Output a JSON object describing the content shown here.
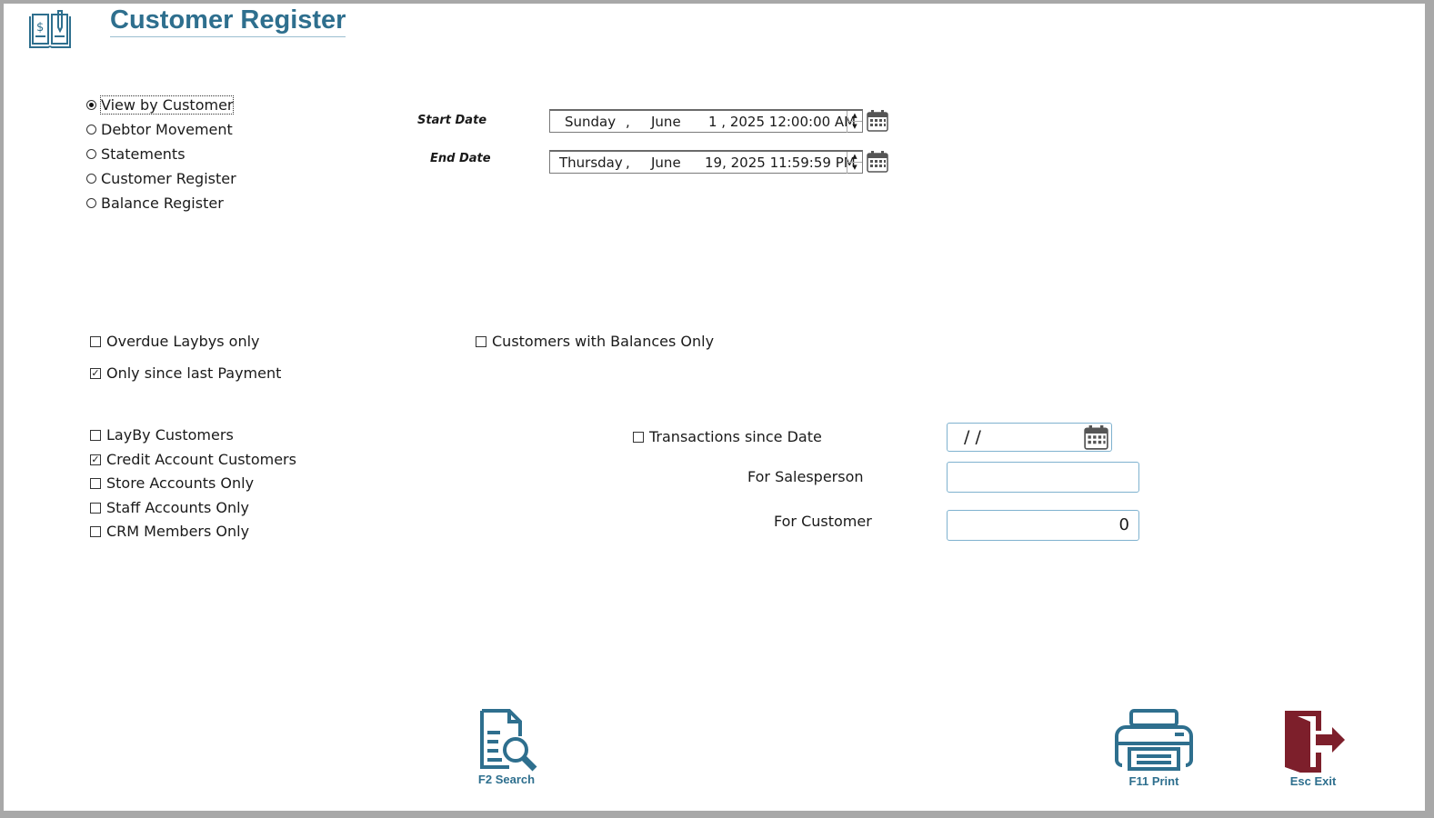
{
  "header": {
    "title": "Customer Register",
    "icon": "ledger-book-icon"
  },
  "report_type": {
    "options": [
      {
        "label": "View by Customer",
        "selected": true
      },
      {
        "label": "Debtor Movement",
        "selected": false
      },
      {
        "label": "Statements",
        "selected": false
      },
      {
        "label": "Customer Register",
        "selected": false
      },
      {
        "label": "Balance Register",
        "selected": false
      }
    ]
  },
  "dates": {
    "start_label": "Start Date",
    "start": {
      "weekday": "Sunday",
      "comma": ",",
      "month": "June",
      "day_time": "1 , 2025 12:00:00 AM"
    },
    "end_label": "End Date",
    "end": {
      "weekday": "Thursday",
      "comma": ",",
      "month": "June",
      "day_time": "19, 2025 11:59:59 PM"
    }
  },
  "filters": {
    "overdue_laybys": {
      "label": "Overdue Laybys only",
      "checked": false
    },
    "only_since_last_payment": {
      "label": "Only since last Payment",
      "checked": true
    },
    "customers_with_balances": {
      "label": "Customers with Balances Only",
      "checked": false
    }
  },
  "customer_types": [
    {
      "label": "LayBy Customers",
      "checked": false
    },
    {
      "label": "Credit Account Customers",
      "checked": true
    },
    {
      "label": "Store Accounts Only",
      "checked": false
    },
    {
      "label": "Staff Accounts Only",
      "checked": false
    },
    {
      "label": "CRM Members Only",
      "checked": false
    }
  ],
  "transactions_since": {
    "label": "Transactions since Date",
    "checked": false,
    "value": " /  /"
  },
  "salesperson": {
    "label": "For Salesperson",
    "value": ""
  },
  "customer": {
    "label": "For Customer",
    "value": "0"
  },
  "buttons": {
    "search": {
      "label": "F2 Search",
      "icon": "search-document-icon"
    },
    "print": {
      "label": "F11 Print",
      "icon": "printer-icon"
    },
    "exit": {
      "label": "Esc Exit",
      "icon": "exit-door-icon"
    }
  },
  "colors": {
    "accent": "#2e6f8e",
    "exit": "#7d1f2b",
    "input_border": "#7fb2cf"
  }
}
